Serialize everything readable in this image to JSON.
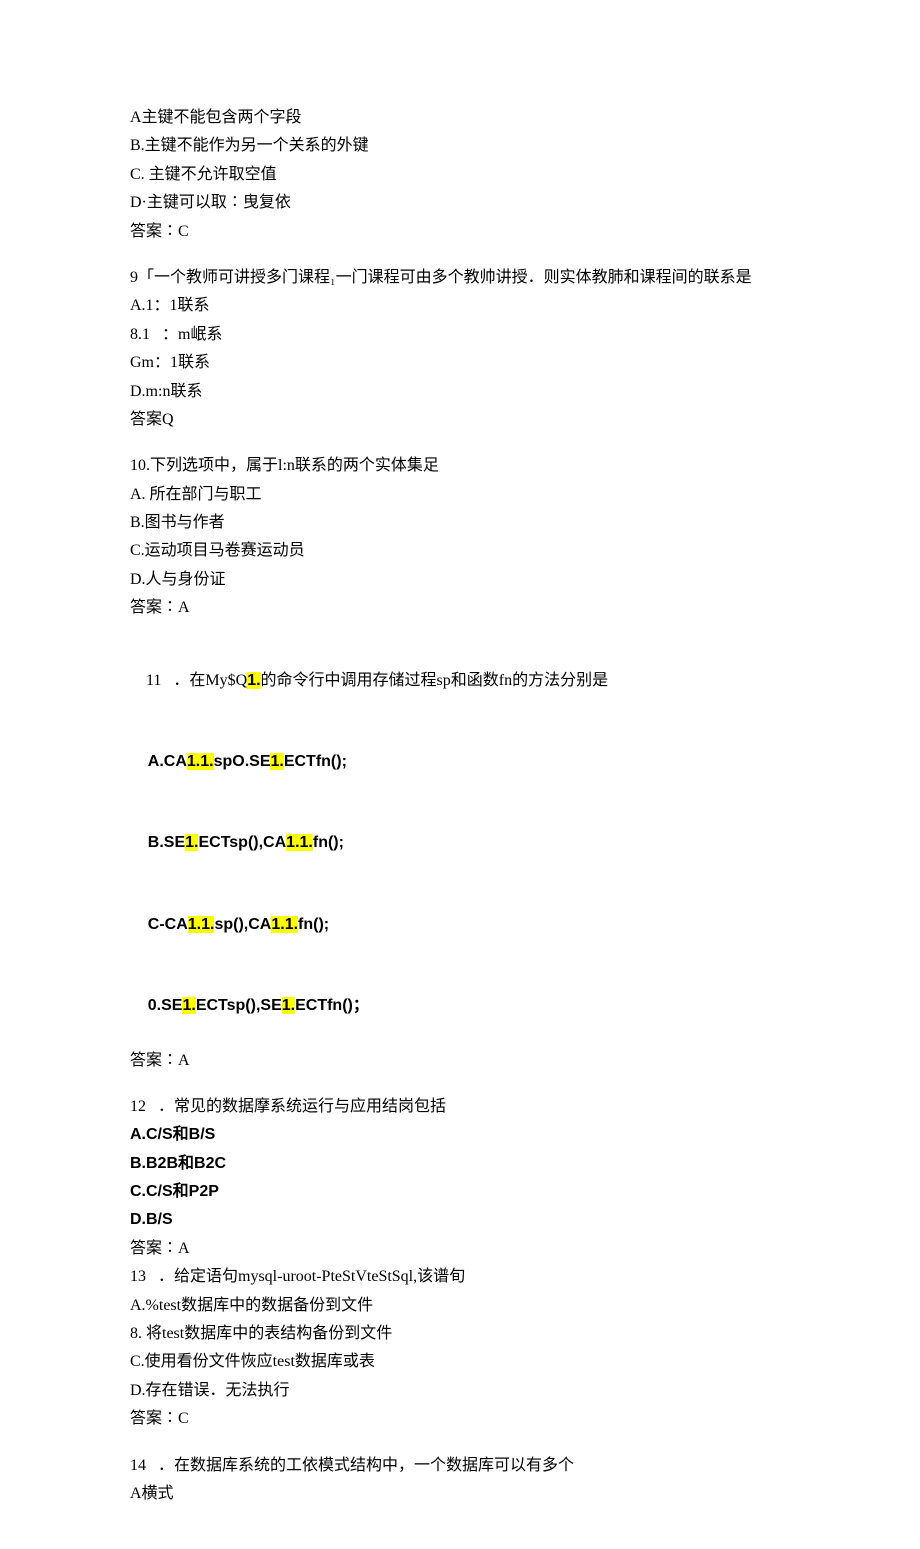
{
  "q8": {
    "a": "A主键不能包含两个字段",
    "b": "B.主键不能作为另一个关系的外键",
    "c": "C. 主键不允许取空值",
    "d": "D·主键可以取∶曳复依",
    "ans": "答案∶C"
  },
  "q9": {
    "stem": "9「一个教师可讲授多门课程₁一门课程可由多个教帅讲授．则实体教肺和课程间的联系是",
    "a": "A.1：1联系",
    "b": "8.1   ：m岷系",
    "c": "Gm：1联系",
    "d": "D.m:n联系",
    "ans": "答案Q"
  },
  "q10": {
    "stem": "10.下列选项中，属于l:n联系的两个实体集足",
    "a": "A. 所在部门与职工",
    "b": "B.图书与作者",
    "c": "C.运动项目马卷赛运动员",
    "d": "D.人与身份证",
    "ans": "答案∶A"
  },
  "q11": {
    "stem_pre": "11   ．在My$Q",
    "stem_hl1": "1.",
    "stem_post": "的命令行中调用存储过程sp和函数fn的方法分别是",
    "a_pre": "A.CA",
    "a_hl1": "1.1.",
    "a_mid": "spO.SE",
    "a_hl2": "1.",
    "a_post": "ECTfn();",
    "b_pre": "B.SE",
    "b_hl1": "1.",
    "b_mid": "ECTsp(),CA",
    "b_hl2": "1.1.",
    "b_post": "fn();",
    "c_pre": "C-CA",
    "c_hl1": "1.1.",
    "c_mid": "sp(),CA",
    "c_hl2": "1.1.",
    "c_post": "fn();",
    "d_pre": "0.SE",
    "d_hl1": "1.",
    "d_mid": "ECTsp(),SE",
    "d_hl2": "1.",
    "d_post": "ECTfn()；",
    "ans": "答案∶A"
  },
  "q12": {
    "stem": "12   ．常见的数据摩系统运行与应用结岗包括",
    "a": "A.C/S和B/S",
    "b": "B.B2B和B2C",
    "c": "C.C/S和P2P",
    "d": "D.B/S",
    "ans": "答案∶A"
  },
  "q13": {
    "stem": "13   ．给定语句mysql-uroot-PteStVteStSql,该谱旬",
    "a": "A.%test数据库中的数据备份到文件",
    "b": "8. 将test数据库中的表结构备份到文件",
    "c": "C.使用看份文件恢应test数据库或表",
    "d": "D.存在错误．无法执行",
    "ans": "答案∶C"
  },
  "q14": {
    "stem": "14   ．在数据库系统的工依模式结构中，一个数据库可以有多个",
    "a": "A横式"
  }
}
